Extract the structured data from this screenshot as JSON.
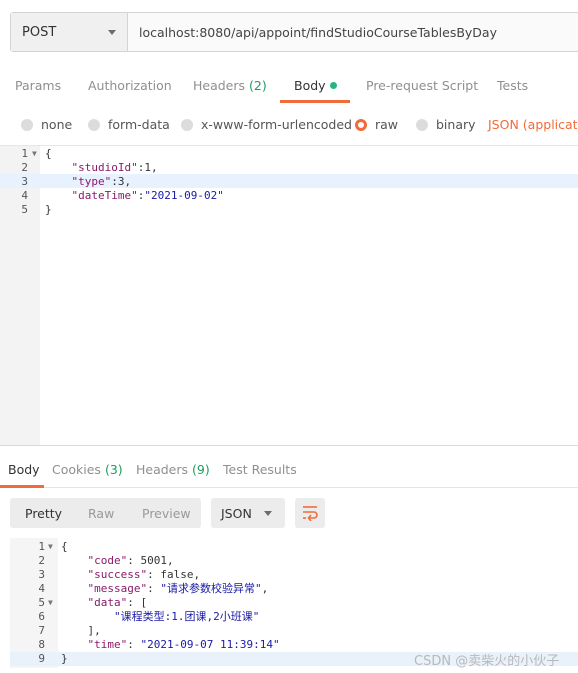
{
  "request": {
    "method": "POST",
    "url": "localhost:8080/api/appoint/findStudioCourseTablesByDay"
  },
  "req_tabs": [
    {
      "label": "Params"
    },
    {
      "label": "Authorization"
    },
    {
      "label": "Headers",
      "count": "(2)"
    },
    {
      "label": "Body"
    },
    {
      "label": "Pre-request Script"
    },
    {
      "label": "Tests"
    }
  ],
  "body_types": [
    "none",
    "form-data",
    "x-www-form-urlencoded",
    "raw",
    "binary"
  ],
  "body_type_selected": "raw",
  "content_type": "JSON (applicatio",
  "request_body": {
    "line_numbers": [
      "1",
      "2",
      "3",
      "4",
      "5"
    ],
    "lines": [
      [
        {
          "t": "{",
          "c": "p"
        }
      ],
      [
        {
          "t": "    ",
          "c": "p"
        },
        {
          "t": "\"studioId\"",
          "c": "k"
        },
        {
          "t": ":1,",
          "c": "p"
        }
      ],
      [
        {
          "t": "    ",
          "c": "p"
        },
        {
          "t": "\"type\"",
          "c": "k"
        },
        {
          "t": ":3,",
          "c": "p"
        }
      ],
      [
        {
          "t": "    ",
          "c": "p"
        },
        {
          "t": "\"dateTime\"",
          "c": "k"
        },
        {
          "t": ":",
          "c": "p"
        },
        {
          "t": "\"2021-09-02\"",
          "c": "s"
        }
      ],
      [
        {
          "t": "}",
          "c": "p"
        }
      ]
    ]
  },
  "res_tabs": [
    {
      "label": "Body"
    },
    {
      "label": "Cookies",
      "count": "(3)"
    },
    {
      "label": "Headers",
      "count": "(9)"
    },
    {
      "label": "Test Results"
    }
  ],
  "view_modes": [
    "Pretty",
    "Raw",
    "Preview"
  ],
  "response_format": "JSON",
  "response_body": {
    "line_numbers": [
      "1",
      "2",
      "3",
      "4",
      "5",
      "6",
      "7",
      "8",
      "9"
    ],
    "lines": [
      [
        {
          "t": "{",
          "c": "p"
        }
      ],
      [
        {
          "t": "    ",
          "c": "p"
        },
        {
          "t": "\"code\"",
          "c": "k"
        },
        {
          "t": ": 5001,",
          "c": "p"
        }
      ],
      [
        {
          "t": "    ",
          "c": "p"
        },
        {
          "t": "\"success\"",
          "c": "k"
        },
        {
          "t": ": false,",
          "c": "p"
        }
      ],
      [
        {
          "t": "    ",
          "c": "p"
        },
        {
          "t": "\"message\"",
          "c": "k"
        },
        {
          "t": ": ",
          "c": "p"
        },
        {
          "t": "\"请求参数校验异常\"",
          "c": "s"
        },
        {
          "t": ",",
          "c": "p"
        }
      ],
      [
        {
          "t": "    ",
          "c": "p"
        },
        {
          "t": "\"data\"",
          "c": "k"
        },
        {
          "t": ": [",
          "c": "p"
        }
      ],
      [
        {
          "t": "        ",
          "c": "p"
        },
        {
          "t": "\"课程类型:1.团课,2小班课\"",
          "c": "s"
        }
      ],
      [
        {
          "t": "    ],",
          "c": "p"
        }
      ],
      [
        {
          "t": "    ",
          "c": "p"
        },
        {
          "t": "\"time\"",
          "c": "k"
        },
        {
          "t": ": ",
          "c": "p"
        },
        {
          "t": "\"2021-09-07 11:39:14\"",
          "c": "s"
        }
      ],
      [
        {
          "t": "}",
          "c": "p"
        }
      ]
    ]
  },
  "watermark": "CSDN @卖柴火的小伙子",
  "colors": {
    "accent": "#f26b3a",
    "count_green": "#1c9e5e",
    "json_key": "#8b1a6b",
    "json_string": "#1a1aa6"
  }
}
